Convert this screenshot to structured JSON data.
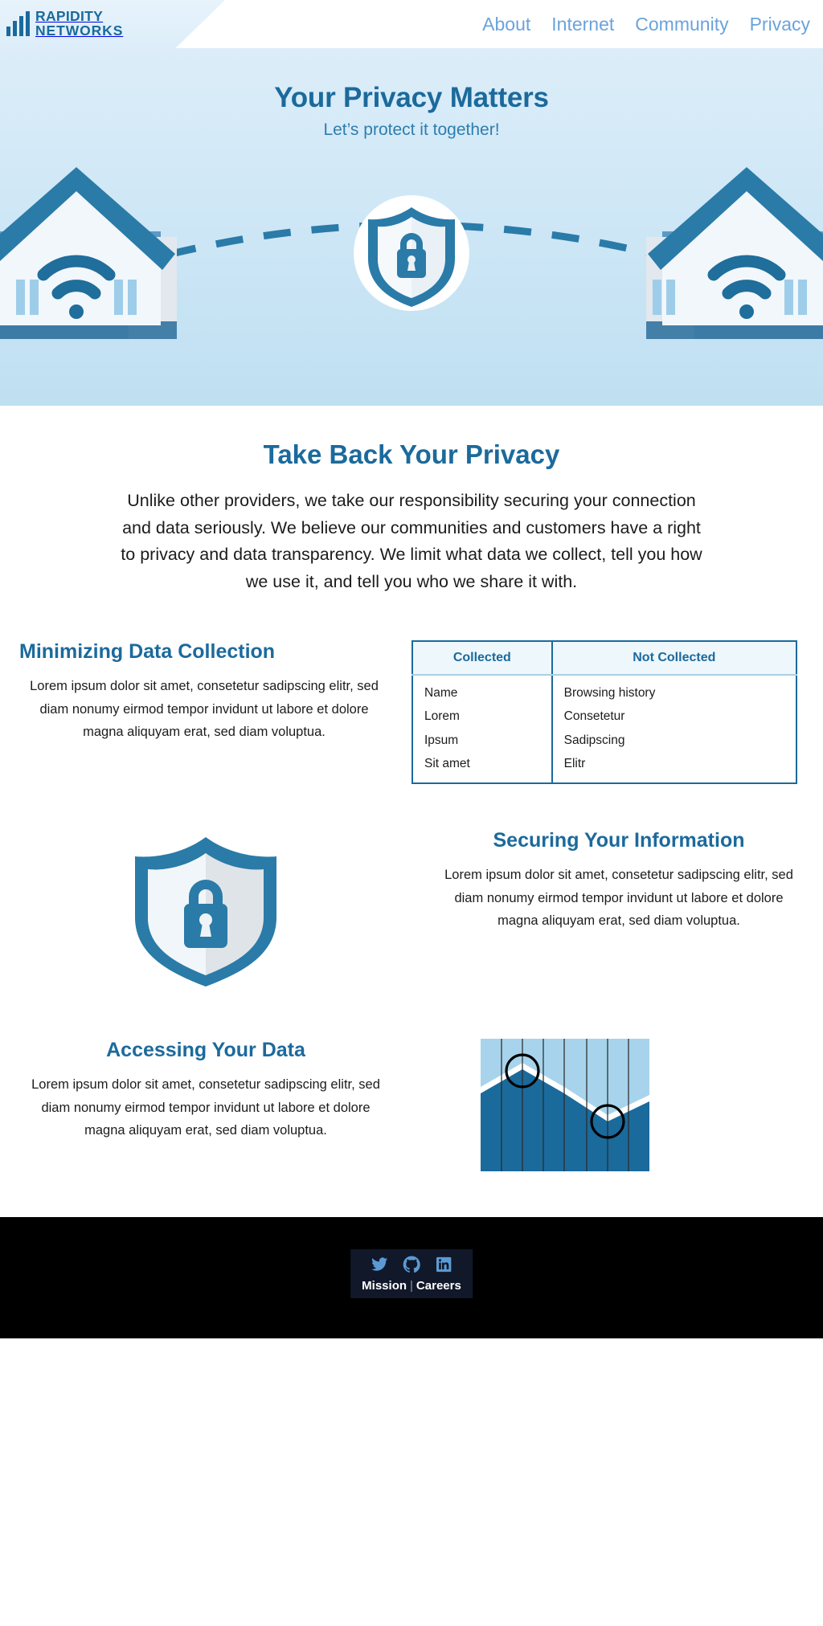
{
  "header": {
    "logo": {
      "line1": "RAPIDITY",
      "line2": "NETWORKS",
      "icon": "bar-chart-logo-icon"
    },
    "nav": [
      {
        "label": "About"
      },
      {
        "label": "Internet"
      },
      {
        "label": "Community"
      },
      {
        "label": "Privacy"
      }
    ]
  },
  "hero": {
    "title": "Your Privacy Matters",
    "subtitle": "Let’s protect it together!",
    "illustration": {
      "name": "two-houses-secure-connection-illustration",
      "center_badge": "shield-lock-icon",
      "left_house": "house-with-wifi-icon",
      "right_house": "house-with-wifi-icon",
      "link": "dashed-connection-arc"
    }
  },
  "intro": {
    "heading": "Take Back Your Privacy",
    "paragraph": "Unlike other providers, we take our responsibility securing your connection and data seriously. We believe our communities and customers have a right to privacy and data transparency. We limit what data we collect, tell you how we use it, and tell you who we share it with."
  },
  "sections": [
    {
      "heading": "Minimizing Data Collection",
      "body": "Lorem ipsum dolor sit amet, consetetur sadipscing elitr, sed diam nonumy eirmod tempor invidunt ut labore et dolore magna aliquyam erat, sed diam voluptua."
    },
    {
      "heading": "Securing Your Information",
      "body": "Lorem ipsum dolor sit amet, consetetur sadipscing elitr, sed diam nonumy eirmod tempor invidunt ut labore et dolore magna aliquyam erat, sed diam voluptua."
    },
    {
      "heading": "Accessing Your Data",
      "body": "Lorem ipsum dolor sit amet, consetetur sadipscing elitr, sed diam nonumy eirmod tempor invidunt ut labore et dolore magna aliquyam erat, sed diam voluptua."
    }
  ],
  "data_table": {
    "columns": [
      "Collected",
      "Not Collected"
    ],
    "rows": [
      [
        "Name",
        "Browsing history"
      ],
      [
        "Lorem",
        "Consetetur"
      ],
      [
        "Ipsum",
        "Sadipscing"
      ],
      [
        "Sit amet",
        "Elitr"
      ]
    ]
  },
  "illustrations": {
    "shield": "shield-with-padlock-icon",
    "chart": "area-chart-with-markers-icon"
  },
  "footer": {
    "social": [
      {
        "name": "twitter-icon",
        "label": "Twitter"
      },
      {
        "name": "github-icon",
        "label": "GitHub"
      },
      {
        "name": "linkedin-icon",
        "label": "LinkedIn"
      }
    ],
    "links": [
      {
        "label": "Mission"
      },
      {
        "label": "Careers"
      }
    ],
    "separator": "|"
  },
  "colors": {
    "brand_blue": "#1b6a9c",
    "nav_blue": "#6ba3dc",
    "hero_top": "#dcedf9",
    "hero_bottom": "#bfe0f2",
    "footer_bg": "#000000",
    "footer_panel": "#11182a"
  }
}
